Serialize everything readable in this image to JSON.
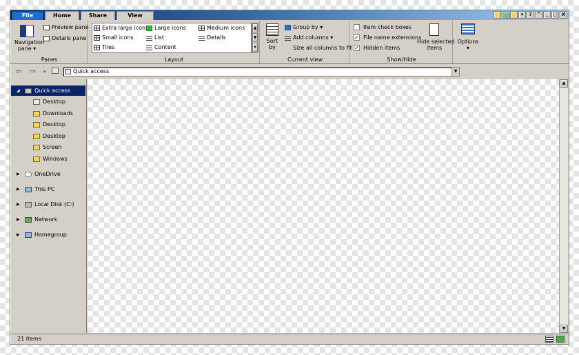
{
  "tabs": {
    "file": "File",
    "home": "Home",
    "share": "Share",
    "view": "View"
  },
  "window_buttons": {
    "help": "?",
    "restore": "^",
    "minimize": "_",
    "maximize": "□",
    "close": "X"
  },
  "ribbon": {
    "panes": {
      "label": "Panes",
      "navigation_pane_line1": "Navigation",
      "navigation_pane_line2": "pane",
      "preview_pane": "Preview pane",
      "details_pane": "Details pane"
    },
    "layout": {
      "label": "Layout",
      "items": [
        "Extra large icons",
        "Large icons",
        "Medium icons",
        "Small icons",
        "List",
        "Details",
        "Tiles",
        "Content"
      ]
    },
    "current_view": {
      "label": "Current view",
      "sort_line1": "Sort",
      "sort_line2": "by",
      "group_by": "Group by",
      "add_columns": "Add columns",
      "size_all_columns": "Size all columns to fit"
    },
    "show_hide": {
      "label": "Show/Hide",
      "item_check_boxes": "Item check boxes",
      "item_check_boxes_checked": false,
      "file_name_extensions": "File name extensions",
      "file_name_extensions_checked": true,
      "hidden_items": "Hidden items",
      "hidden_items_checked": true,
      "hide_selected_line1": "Hide selected",
      "hide_selected_line2": "items"
    },
    "options": {
      "label": "Options"
    }
  },
  "address_bar": {
    "path": "Quick access"
  },
  "nav_pane": {
    "quick_access": "Quick access",
    "quick_items": [
      "Desktop",
      "Downloads",
      "Desktop",
      "Desktop",
      "Screen",
      "Windows"
    ],
    "onedrive": "OneDrive",
    "this_pc": "This PC",
    "local_disk": "Local Disk (C:)",
    "network": "Network",
    "homegroup": "Homegroup"
  },
  "status_bar": {
    "item_count": "21 items"
  },
  "colors": {
    "selection": "#0a246a",
    "file_tab": "#1c6fd1",
    "window_face": "#d4d0c8"
  }
}
